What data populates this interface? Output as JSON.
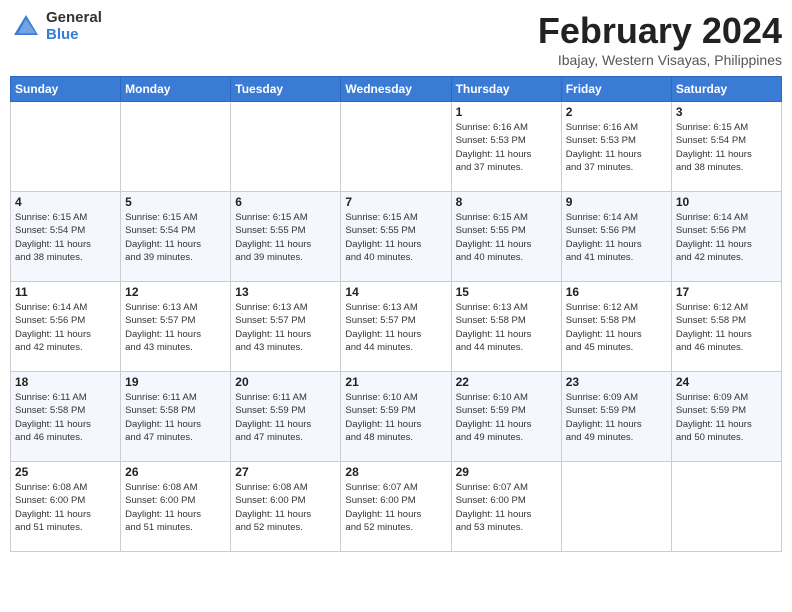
{
  "logo": {
    "general": "General",
    "blue": "Blue"
  },
  "title": "February 2024",
  "location": "Ibajay, Western Visayas, Philippines",
  "days_of_week": [
    "Sunday",
    "Monday",
    "Tuesday",
    "Wednesday",
    "Thursday",
    "Friday",
    "Saturday"
  ],
  "weeks": [
    [
      {
        "day": "",
        "info": ""
      },
      {
        "day": "",
        "info": ""
      },
      {
        "day": "",
        "info": ""
      },
      {
        "day": "",
        "info": ""
      },
      {
        "day": "1",
        "info": "Sunrise: 6:16 AM\nSunset: 5:53 PM\nDaylight: 11 hours\nand 37 minutes."
      },
      {
        "day": "2",
        "info": "Sunrise: 6:16 AM\nSunset: 5:53 PM\nDaylight: 11 hours\nand 37 minutes."
      },
      {
        "day": "3",
        "info": "Sunrise: 6:15 AM\nSunset: 5:54 PM\nDaylight: 11 hours\nand 38 minutes."
      }
    ],
    [
      {
        "day": "4",
        "info": "Sunrise: 6:15 AM\nSunset: 5:54 PM\nDaylight: 11 hours\nand 38 minutes."
      },
      {
        "day": "5",
        "info": "Sunrise: 6:15 AM\nSunset: 5:54 PM\nDaylight: 11 hours\nand 39 minutes."
      },
      {
        "day": "6",
        "info": "Sunrise: 6:15 AM\nSunset: 5:55 PM\nDaylight: 11 hours\nand 39 minutes."
      },
      {
        "day": "7",
        "info": "Sunrise: 6:15 AM\nSunset: 5:55 PM\nDaylight: 11 hours\nand 40 minutes."
      },
      {
        "day": "8",
        "info": "Sunrise: 6:15 AM\nSunset: 5:55 PM\nDaylight: 11 hours\nand 40 minutes."
      },
      {
        "day": "9",
        "info": "Sunrise: 6:14 AM\nSunset: 5:56 PM\nDaylight: 11 hours\nand 41 minutes."
      },
      {
        "day": "10",
        "info": "Sunrise: 6:14 AM\nSunset: 5:56 PM\nDaylight: 11 hours\nand 42 minutes."
      }
    ],
    [
      {
        "day": "11",
        "info": "Sunrise: 6:14 AM\nSunset: 5:56 PM\nDaylight: 11 hours\nand 42 minutes."
      },
      {
        "day": "12",
        "info": "Sunrise: 6:13 AM\nSunset: 5:57 PM\nDaylight: 11 hours\nand 43 minutes."
      },
      {
        "day": "13",
        "info": "Sunrise: 6:13 AM\nSunset: 5:57 PM\nDaylight: 11 hours\nand 43 minutes."
      },
      {
        "day": "14",
        "info": "Sunrise: 6:13 AM\nSunset: 5:57 PM\nDaylight: 11 hours\nand 44 minutes."
      },
      {
        "day": "15",
        "info": "Sunrise: 6:13 AM\nSunset: 5:58 PM\nDaylight: 11 hours\nand 44 minutes."
      },
      {
        "day": "16",
        "info": "Sunrise: 6:12 AM\nSunset: 5:58 PM\nDaylight: 11 hours\nand 45 minutes."
      },
      {
        "day": "17",
        "info": "Sunrise: 6:12 AM\nSunset: 5:58 PM\nDaylight: 11 hours\nand 46 minutes."
      }
    ],
    [
      {
        "day": "18",
        "info": "Sunrise: 6:11 AM\nSunset: 5:58 PM\nDaylight: 11 hours\nand 46 minutes."
      },
      {
        "day": "19",
        "info": "Sunrise: 6:11 AM\nSunset: 5:58 PM\nDaylight: 11 hours\nand 47 minutes."
      },
      {
        "day": "20",
        "info": "Sunrise: 6:11 AM\nSunset: 5:59 PM\nDaylight: 11 hours\nand 47 minutes."
      },
      {
        "day": "21",
        "info": "Sunrise: 6:10 AM\nSunset: 5:59 PM\nDaylight: 11 hours\nand 48 minutes."
      },
      {
        "day": "22",
        "info": "Sunrise: 6:10 AM\nSunset: 5:59 PM\nDaylight: 11 hours\nand 49 minutes."
      },
      {
        "day": "23",
        "info": "Sunrise: 6:09 AM\nSunset: 5:59 PM\nDaylight: 11 hours\nand 49 minutes."
      },
      {
        "day": "24",
        "info": "Sunrise: 6:09 AM\nSunset: 5:59 PM\nDaylight: 11 hours\nand 50 minutes."
      }
    ],
    [
      {
        "day": "25",
        "info": "Sunrise: 6:08 AM\nSunset: 6:00 PM\nDaylight: 11 hours\nand 51 minutes."
      },
      {
        "day": "26",
        "info": "Sunrise: 6:08 AM\nSunset: 6:00 PM\nDaylight: 11 hours\nand 51 minutes."
      },
      {
        "day": "27",
        "info": "Sunrise: 6:08 AM\nSunset: 6:00 PM\nDaylight: 11 hours\nand 52 minutes."
      },
      {
        "day": "28",
        "info": "Sunrise: 6:07 AM\nSunset: 6:00 PM\nDaylight: 11 hours\nand 52 minutes."
      },
      {
        "day": "29",
        "info": "Sunrise: 6:07 AM\nSunset: 6:00 PM\nDaylight: 11 hours\nand 53 minutes."
      },
      {
        "day": "",
        "info": ""
      },
      {
        "day": "",
        "info": ""
      }
    ]
  ]
}
